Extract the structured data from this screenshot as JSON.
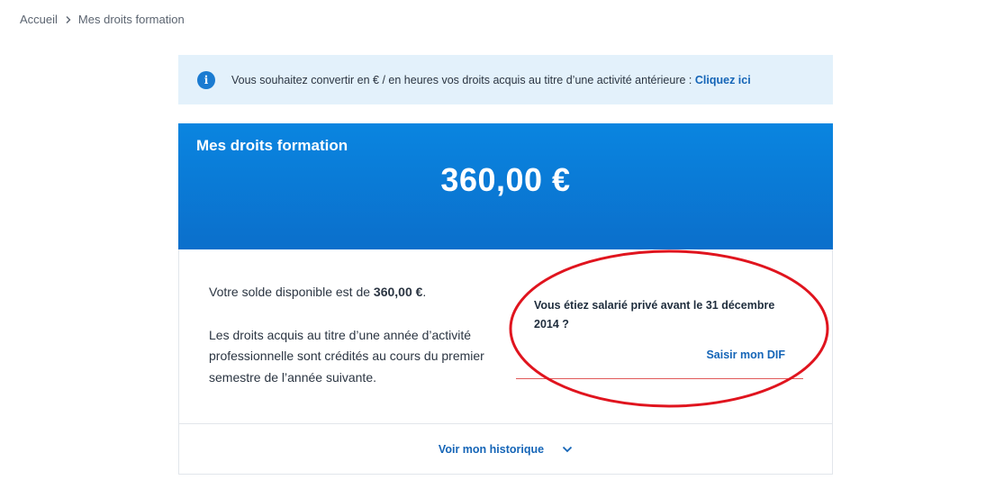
{
  "breadcrumb": {
    "home": "Accueil",
    "current": "Mes droits formation"
  },
  "info_banner": {
    "text": "Vous souhaitez convertir en € / en heures vos droits acquis au titre d’une activité antérieure : ",
    "link": "Cliquez ici",
    "icon": "info-icon"
  },
  "card": {
    "title": "Mes droits formation",
    "amount": "360,00 €",
    "balance_prefix": "Votre solde disponible est de ",
    "balance_value": "360,00 €",
    "balance_suffix": ".",
    "credit_note": "Les droits acquis au titre d’une année d’activité professionnelle sont crédités au cours du premier semestre de l’année suivante.",
    "dif_question": "Vous étiez salarié privé avant le 31 décembre 2014 ?",
    "dif_link": "Saisir mon DIF",
    "history_link": "Voir mon historique"
  },
  "colors": {
    "header_blue": "#0b7ad6",
    "link_blue": "#1565b7",
    "banner_bg": "#e3f1fb",
    "annotation_red": "#e0141e"
  }
}
